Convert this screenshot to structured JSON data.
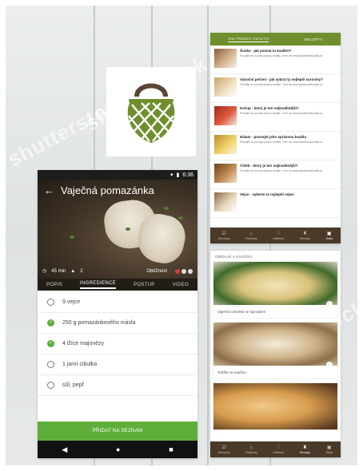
{
  "background": {
    "watermark_text": "shutterstock",
    "colors": {
      "wood": "#e3e6e6",
      "accent_green": "#5fae3b",
      "olive": "#6f8f2e",
      "brown": "#4b3a29"
    }
  },
  "logo": {
    "icon": "net-bag-icon",
    "color": "#6f8f2e",
    "handle_color": "#5b4634"
  },
  "left_phone": {
    "status_time": "6:36",
    "title": "Vaječná pomazánka",
    "time_info": "45 min",
    "portion_info": "2",
    "difficulty_label": "Obtížnost",
    "tabs": [
      "POPIS",
      "INGREDIENCE",
      "POSTUP",
      "VIDEO"
    ],
    "active_tab": "INGREDIENCE",
    "ingredients": [
      {
        "text": "9 vejce",
        "checked": false
      },
      {
        "text": "250 g pomazánkového másla",
        "checked": true
      },
      {
        "text": "4 lžíce majonézy",
        "checked": true
      },
      {
        "text": "1 jarní cibulka",
        "checked": false
      },
      {
        "text": "sůl, pepř",
        "checked": false
      }
    ],
    "add_button": "PŘIDAT NA SEZNAM",
    "nav_icons": [
      "back-icon",
      "home-icon",
      "recents-icon"
    ]
  },
  "right_top_phone": {
    "tabs": [
      "JAK POZNAT KVALITU",
      "RECEPTY"
    ],
    "active_tab": "JAK POZNAT KVALITU",
    "articles": [
      {
        "title": "Šunka - jak poznat tu kvalitní?",
        "desc": "Použijte se poznat pravou kvalitu. Více na www.akademiekvality.cz"
      },
      {
        "title": "Vánoční pečení - jak vybrat ty nejlepší suroviny?",
        "desc": "Použijte se poznat pravou kvalitu. Více na www.akademiekvality.cz"
      },
      {
        "title": "Kečup - který je ten nejkvalitnější?",
        "desc": "Použijte se poznat pravou kvalitu. Více na www.akademiekvality.cz"
      },
      {
        "title": "Eidam - poznejte jeho správnou kvalitu",
        "desc": "Použijte se poznat pravou kvalitu. Více na www.akademiekvality.cz"
      },
      {
        "title": "Chléb - který je ten nejkvalitnější?",
        "desc": "Použijte se poznat pravou kvalitu. Více na www.akademiekvality.cz"
      },
      {
        "title": "Vejce - vyberte ta nejlepší nejen",
        "desc": ""
      }
    ],
    "bottom_nav": [
      "Seznamy",
      "Potraviny",
      "Oblíbené",
      "Recepty",
      "Videa"
    ],
    "bottom_nav_active": "Videa"
  },
  "right_bottom_phone": {
    "header": "OBÍDAJE A SVAČINY",
    "cards": [
      {
        "label": "Vaječná omeleta se špenátem"
      },
      {
        "label": "Tortilla na svačinu"
      },
      {
        "label": ""
      }
    ],
    "bottom_nav": [
      "Seznamy",
      "Potraviny",
      "Oblíbené",
      "Recepty",
      "Videa"
    ],
    "bottom_nav_active": "Recepty"
  }
}
